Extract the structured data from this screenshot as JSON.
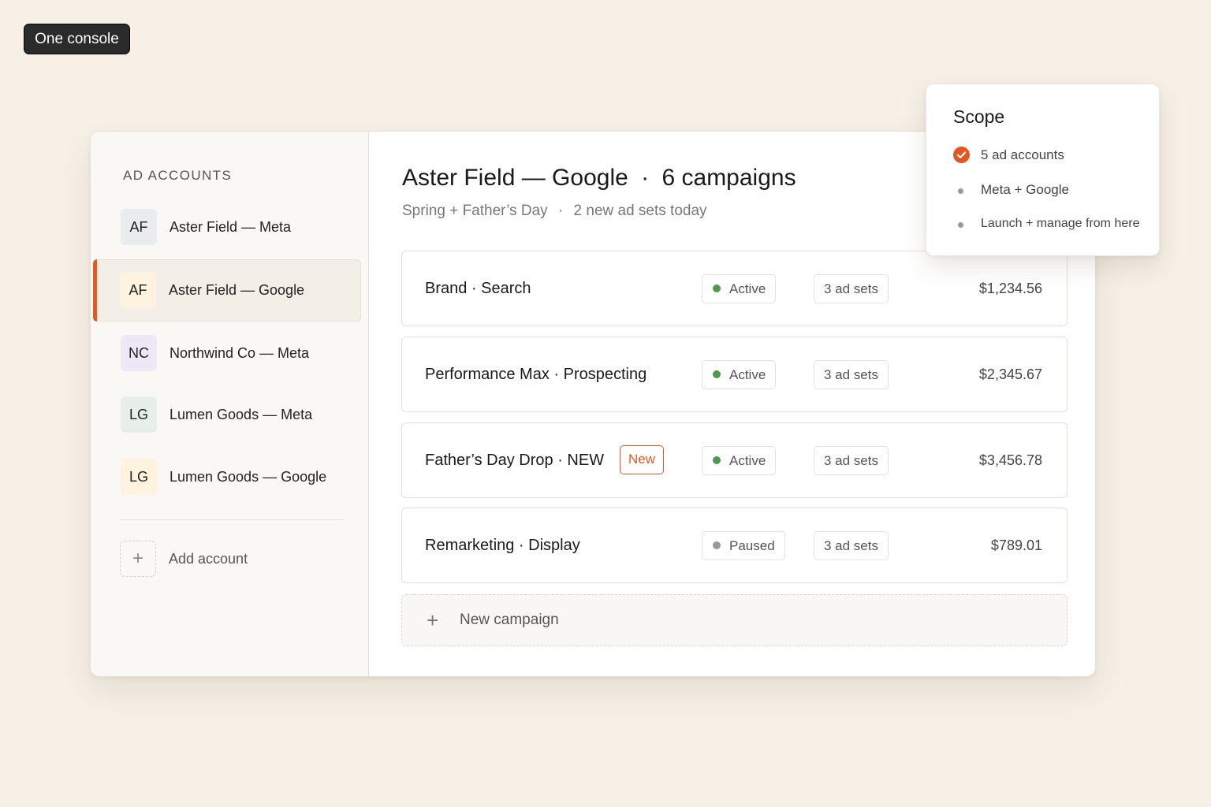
{
  "tag": {
    "label": "One console"
  },
  "sidebar": {
    "heading": "AD ACCOUNTS",
    "accounts": [
      {
        "initials": "AF",
        "label": "Aster Field — Meta",
        "avatar_bg": "#e9ecec",
        "selected": false
      },
      {
        "initials": "AF",
        "label": "Aster Field — Google",
        "avatar_bg": "#fdf3df",
        "selected": true
      },
      {
        "initials": "NC",
        "label": "Northwind Co — Meta",
        "avatar_bg": "#ece8f6",
        "selected": false
      },
      {
        "initials": "LG",
        "label": "Lumen Goods — Meta",
        "avatar_bg": "#e8efe9",
        "selected": false
      },
      {
        "initials": "LG",
        "label": "Lumen Goods — Google",
        "avatar_bg": "#fdf3df",
        "selected": false
      }
    ],
    "add_account": {
      "icon": "plus-icon",
      "label": "Add account"
    }
  },
  "main": {
    "title_account": "Aster Field — Google",
    "title_sep": "·",
    "title_count": "6 campaigns",
    "subtitle_left": "Spring + Father’s Day",
    "subtitle_sep": "·",
    "subtitle_right": "2 new ad sets today",
    "campaigns": [
      {
        "name": "Brand · Search",
        "badge": "",
        "status": "Active",
        "status_color": "#4c9a4a",
        "ad_sets": "3 ad sets",
        "amount": "$1,234.56"
      },
      {
        "name": "Performance Max · Prospecting",
        "badge": "",
        "status": "Active",
        "status_color": "#4c9a4a",
        "ad_sets": "3 ad sets",
        "amount": "$2,345.67"
      },
      {
        "name": "Father’s Day Drop · NEW",
        "badge": "New",
        "status": "Active",
        "status_color": "#4c9a4a",
        "ad_sets": "3 ad sets",
        "amount": "$3,456.78"
      },
      {
        "name": "Remarketing · Display",
        "badge": "",
        "status": "Paused",
        "status_color": "#9a9a9a",
        "ad_sets": "3 ad sets",
        "amount": "$789.01"
      }
    ],
    "new_campaign": {
      "icon": "plus-icon",
      "label": "New campaign"
    }
  },
  "scope": {
    "title": "Scope",
    "items": [
      {
        "icon": "check-circle-icon",
        "text": "5 ad accounts"
      },
      {
        "icon": "bullet-icon",
        "text": "Meta + Google"
      },
      {
        "icon": "bullet-icon",
        "text": "Launch + manage from here"
      }
    ]
  },
  "colors": {
    "accent": "#e05a22",
    "background": "#f6f0e7",
    "active": "#4c9a4a",
    "paused": "#9a9a9a"
  }
}
